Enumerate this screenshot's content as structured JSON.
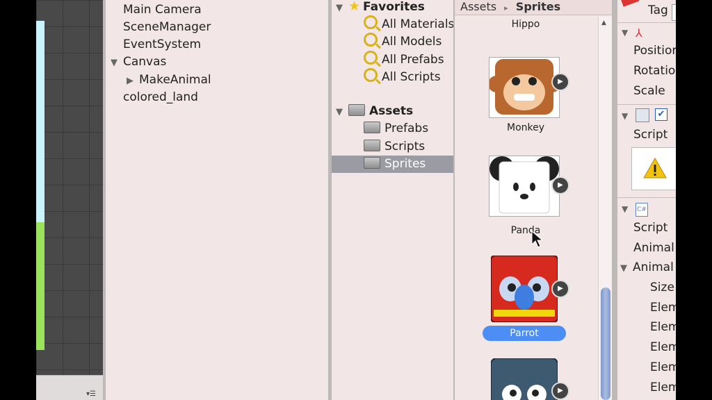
{
  "hierarchy": {
    "items": [
      {
        "label": "Main Camera"
      },
      {
        "label": "SceneManager"
      },
      {
        "label": "EventSystem"
      },
      {
        "label": "Canvas"
      },
      {
        "label": "MakeAnimal"
      },
      {
        "label": "colored_land"
      }
    ]
  },
  "project": {
    "favorites": {
      "label": "Favorites",
      "items": [
        "All Materials",
        "All Models",
        "All Prefabs",
        "All Scripts"
      ]
    },
    "assets": {
      "label": "Assets",
      "items": [
        "Prefabs",
        "Scripts",
        "Sprites"
      ],
      "selected": "Sprites"
    }
  },
  "sprites": {
    "breadcrumb": {
      "root": "Assets",
      "sep": "▸",
      "current": "Sprites"
    },
    "items": [
      {
        "label": "Hippo"
      },
      {
        "label": "Monkey"
      },
      {
        "label": "Panda"
      },
      {
        "label": "Parrot",
        "selected": true
      }
    ],
    "colors": {
      "selection": "#4d8ef5",
      "monkey": "#b8672f",
      "parrot": "#d62a1e",
      "penguin": "#3e5a70"
    }
  },
  "inspector": {
    "tag_label": "Tag",
    "transform": [
      "Position",
      "Rotation",
      "Scale"
    ],
    "component1": {
      "script_label": "Script"
    },
    "component2": {
      "script_label": "Script",
      "field": "Animal",
      "array_label": "Animal",
      "size_label": "Size",
      "elements": [
        "Elem",
        "Elem",
        "Elem",
        "Elem",
        "Elem"
      ]
    }
  },
  "scene": {
    "menu_icon": "lines-icon"
  }
}
